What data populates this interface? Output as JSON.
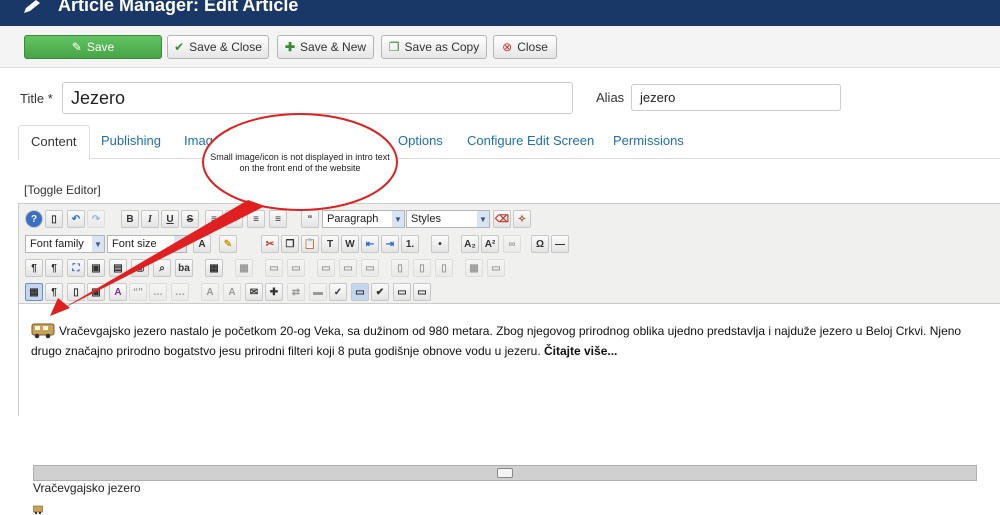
{
  "header": {
    "title": "Article Manager: Edit Article",
    "icon": "pencil-icon"
  },
  "toolbar": {
    "save": "Save",
    "save_close": "Save & Close",
    "save_new": "Save & New",
    "save_copy": "Save as Copy",
    "close": "Close"
  },
  "form": {
    "title_label": "Title *",
    "title_value": "Jezero",
    "alias_label": "Alias",
    "alias_value": "jezero"
  },
  "tabs": [
    "Content",
    "Publishing",
    "Imag",
    "Options",
    "Configure Edit Screen",
    "Permissions"
  ],
  "editor": {
    "toggle": "[Toggle Editor]",
    "format_select": "Paragraph",
    "styles_select": "Styles",
    "font_family": "Font family",
    "font_size": "Font size"
  },
  "content": {
    "paragraph": "Vračevgajsko jezero nastalo je početkom 20-og Veka, sa dužinom od 980 metara. Zbog njegovog prirodnog oblika ujedno predstavlja i najduže jezero u Beloj Crkvi. Njeno drugo značajno prirodno bogatstvo jesu prirodni filteri koji 8 puta godišnje obnove vodu u jezeru.",
    "read_more": "Čitajte više...",
    "subtitle": "Vračevgajsko jezero"
  },
  "annotation": {
    "text": "Small image/icon is not displayed in intro text on the front end of the website",
    "color": "#e02020"
  }
}
